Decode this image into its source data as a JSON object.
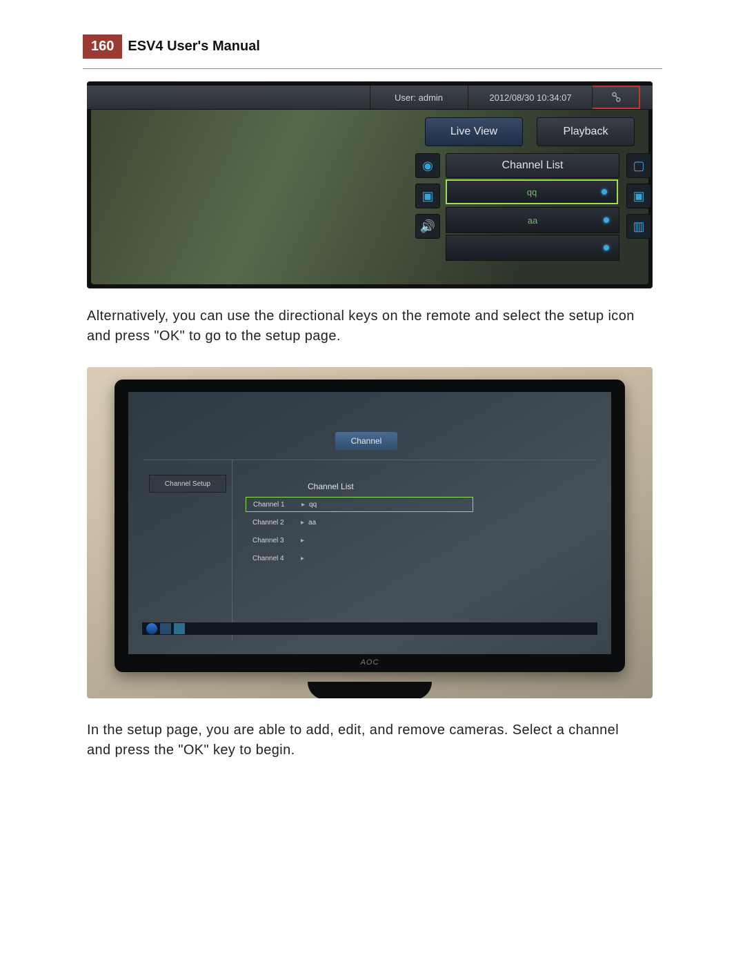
{
  "page_number": "160",
  "manual_title": "ESV4 User's Manual",
  "paragraph1": "Alternatively, you can use the directional keys on the remote and select the setup icon and press \"OK\" to go to the setup page.",
  "paragraph2": "In the setup page, you are able to add, edit, and remove cameras. Select a channel and press the \"OK\" key to begin.",
  "screenshot1": {
    "user_label": "User: admin",
    "timestamp": "2012/08/30 10:34:07",
    "btn_live": "Live View",
    "btn_play": "Playback",
    "panel_title": "Channel List",
    "rows": [
      {
        "label": "qq",
        "active": true
      },
      {
        "label": "aa",
        "active": true
      },
      {
        "label": "",
        "active": true
      }
    ]
  },
  "screenshot2": {
    "tab_label": "Channel",
    "sidebar_label": "Channel Setup",
    "list_title": "Channel List",
    "channels": [
      {
        "slot": "Channel 1",
        "name": "qq"
      },
      {
        "slot": "Channel 2",
        "name": "aa"
      },
      {
        "slot": "Channel 3",
        "name": ""
      },
      {
        "slot": "Channel 4",
        "name": ""
      }
    ],
    "monitor_brand": "AOC"
  }
}
